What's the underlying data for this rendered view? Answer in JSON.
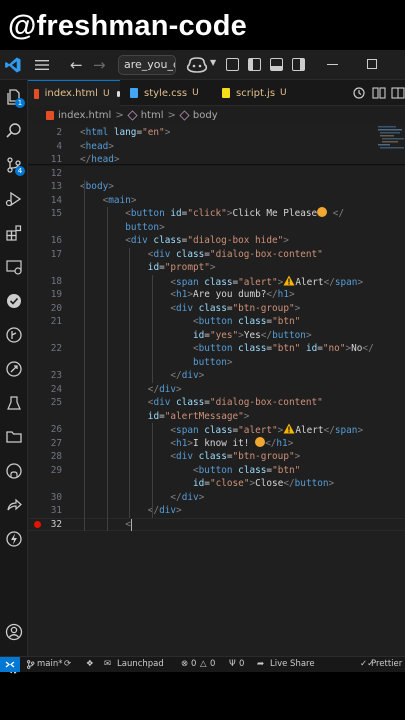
{
  "watermark": "@freshman-code",
  "titlebar": {
    "search_value": "are_you_dumb"
  },
  "tabs": [
    {
      "label": "index.html",
      "status": "U",
      "modified": true,
      "active": true,
      "color": "#e44d26"
    },
    {
      "label": "style.css",
      "status": "U",
      "active": false,
      "color": "#42a5f5"
    },
    {
      "label": "script.js",
      "status": "U",
      "active": false,
      "color": "#f5de19"
    }
  ],
  "breadcrumb": {
    "file": "index.html",
    "sep": ">",
    "html": "html",
    "body": "body"
  },
  "activity_badges": {
    "explorer": "1",
    "source_control": "4"
  },
  "editor": {
    "lines": [
      {
        "n": "2",
        "indent": 0,
        "parts": [
          [
            "t",
            "<"
          ],
          [
            "tag",
            "html"
          ],
          [
            "attr",
            " lang"
          ],
          [
            "txt",
            "="
          ],
          [
            "str",
            "\"en\""
          ],
          [
            "t",
            ">"
          ]
        ]
      },
      {
        "n": "4",
        "indent": 0,
        "parts": [
          [
            "t",
            "<"
          ],
          [
            "tag",
            "head"
          ],
          [
            "t",
            ">"
          ]
        ]
      },
      {
        "n": "11",
        "indent": 0,
        "parts": [
          [
            "t",
            "</"
          ],
          [
            "tag",
            "head"
          ],
          [
            "t",
            ">"
          ]
        ]
      },
      {
        "n": "12",
        "indent": 0,
        "parts": []
      },
      {
        "n": "13",
        "indent": 0,
        "parts": [
          [
            "t",
            "<"
          ],
          [
            "tag",
            "body"
          ],
          [
            "t",
            ">"
          ]
        ]
      },
      {
        "n": "14",
        "indent": 1,
        "parts": [
          [
            "t",
            "<"
          ],
          [
            "tag",
            "main"
          ],
          [
            "t",
            ">"
          ]
        ]
      },
      {
        "n": "15",
        "indent": 2,
        "parts": [
          [
            "t",
            "<"
          ],
          [
            "tag",
            "button"
          ],
          [
            "attr",
            " id"
          ],
          [
            "txt",
            "="
          ],
          [
            "str",
            "\"click\""
          ],
          [
            "t",
            ">"
          ],
          [
            "txt",
            "Click Me Please"
          ],
          [
            "emoji",
            ""
          ],
          [
            "t",
            " </"
          ]
        ]
      },
      {
        "n": "",
        "indent": 2,
        "parts": [
          [
            "tag",
            "button"
          ],
          [
            "t",
            ">"
          ]
        ]
      },
      {
        "n": "16",
        "indent": 2,
        "parts": [
          [
            "t",
            "<"
          ],
          [
            "tag",
            "div"
          ],
          [
            "attr",
            " class"
          ],
          [
            "txt",
            "="
          ],
          [
            "str",
            "\"dialog-box hide\""
          ],
          [
            "t",
            ">"
          ]
        ]
      },
      {
        "n": "17",
        "indent": 3,
        "parts": [
          [
            "t",
            "<"
          ],
          [
            "tag",
            "div"
          ],
          [
            "attr",
            " class"
          ],
          [
            "txt",
            "="
          ],
          [
            "str",
            "\"dialog-box-content\""
          ]
        ]
      },
      {
        "n": "",
        "indent": 3,
        "parts": [
          [
            "attr",
            "id"
          ],
          [
            "txt",
            "="
          ],
          [
            "str",
            "\"prompt\""
          ],
          [
            "t",
            ">"
          ]
        ]
      },
      {
        "n": "18",
        "indent": 4,
        "parts": [
          [
            "t",
            "<"
          ],
          [
            "tag",
            "span"
          ],
          [
            "attr",
            " class"
          ],
          [
            "txt",
            "="
          ],
          [
            "str",
            "\"alert\""
          ],
          [
            "t",
            ">"
          ],
          [
            "warn",
            ""
          ],
          [
            "txt",
            "Alert"
          ],
          [
            "t",
            "</"
          ],
          [
            "tag",
            "span"
          ],
          [
            "t",
            ">"
          ]
        ]
      },
      {
        "n": "19",
        "indent": 4,
        "parts": [
          [
            "t",
            "<"
          ],
          [
            "tag",
            "h1"
          ],
          [
            "t",
            ">"
          ],
          [
            "txt",
            "Are you dumb?"
          ],
          [
            "t",
            "</"
          ],
          [
            "tag",
            "h1"
          ],
          [
            "t",
            ">"
          ]
        ]
      },
      {
        "n": "20",
        "indent": 4,
        "parts": [
          [
            "t",
            "<"
          ],
          [
            "tag",
            "div"
          ],
          [
            "attr",
            " class"
          ],
          [
            "txt",
            "="
          ],
          [
            "str",
            "\"btn-group\""
          ],
          [
            "t",
            ">"
          ]
        ]
      },
      {
        "n": "21",
        "indent": 5,
        "parts": [
          [
            "t",
            "<"
          ],
          [
            "tag",
            "button"
          ],
          [
            "attr",
            " class"
          ],
          [
            "txt",
            "="
          ],
          [
            "str",
            "\"btn\""
          ]
        ]
      },
      {
        "n": "",
        "indent": 5,
        "parts": [
          [
            "attr",
            "id"
          ],
          [
            "txt",
            "="
          ],
          [
            "str",
            "\"yes\""
          ],
          [
            "t",
            ">"
          ],
          [
            "txt",
            "Yes"
          ],
          [
            "t",
            "</"
          ],
          [
            "tag",
            "button"
          ],
          [
            "t",
            ">"
          ]
        ]
      },
      {
        "n": "22",
        "indent": 5,
        "parts": [
          [
            "t",
            "<"
          ],
          [
            "tag",
            "button"
          ],
          [
            "attr",
            " class"
          ],
          [
            "txt",
            "="
          ],
          [
            "str",
            "\"btn\""
          ],
          [
            "attr",
            " id"
          ],
          [
            "txt",
            "="
          ],
          [
            "str",
            "\"no\""
          ],
          [
            "t",
            ">"
          ],
          [
            "txt",
            "No"
          ],
          [
            "t",
            "</"
          ]
        ]
      },
      {
        "n": "",
        "indent": 5,
        "parts": [
          [
            "tag",
            "button"
          ],
          [
            "t",
            ">"
          ]
        ]
      },
      {
        "n": "23",
        "indent": 4,
        "parts": [
          [
            "t",
            "</"
          ],
          [
            "tag",
            "div"
          ],
          [
            "t",
            ">"
          ]
        ]
      },
      {
        "n": "24",
        "indent": 3,
        "parts": [
          [
            "t",
            "</"
          ],
          [
            "tag",
            "div"
          ],
          [
            "t",
            ">"
          ]
        ]
      },
      {
        "n": "25",
        "indent": 3,
        "parts": [
          [
            "t",
            "<"
          ],
          [
            "tag",
            "div"
          ],
          [
            "attr",
            " class"
          ],
          [
            "txt",
            "="
          ],
          [
            "str",
            "\"dialog-box-content\""
          ]
        ]
      },
      {
        "n": "",
        "indent": 3,
        "parts": [
          [
            "attr",
            "id"
          ],
          [
            "txt",
            "="
          ],
          [
            "str",
            "\"alertMessage\""
          ],
          [
            "t",
            ">"
          ]
        ]
      },
      {
        "n": "26",
        "indent": 4,
        "parts": [
          [
            "t",
            "<"
          ],
          [
            "tag",
            "span"
          ],
          [
            "attr",
            " class"
          ],
          [
            "txt",
            "="
          ],
          [
            "str",
            "\"alert\""
          ],
          [
            "t",
            ">"
          ],
          [
            "warn",
            ""
          ],
          [
            "txt",
            "Alert"
          ],
          [
            "t",
            "</"
          ],
          [
            "tag",
            "span"
          ],
          [
            "t",
            ">"
          ]
        ]
      },
      {
        "n": "27",
        "indent": 4,
        "parts": [
          [
            "t",
            "<"
          ],
          [
            "tag",
            "h1"
          ],
          [
            "t",
            ">"
          ],
          [
            "txt",
            "I know it! "
          ],
          [
            "emoji",
            ""
          ],
          [
            "t",
            "</"
          ],
          [
            "tag",
            "h1"
          ],
          [
            "t",
            ">"
          ]
        ]
      },
      {
        "n": "28",
        "indent": 4,
        "parts": [
          [
            "t",
            "<"
          ],
          [
            "tag",
            "div"
          ],
          [
            "attr",
            " class"
          ],
          [
            "txt",
            "="
          ],
          [
            "str",
            "\"btn-group\""
          ],
          [
            "t",
            ">"
          ]
        ]
      },
      {
        "n": "29",
        "indent": 5,
        "parts": [
          [
            "t",
            "<"
          ],
          [
            "tag",
            "button"
          ],
          [
            "attr",
            " class"
          ],
          [
            "txt",
            "="
          ],
          [
            "str",
            "\"btn\""
          ]
        ]
      },
      {
        "n": "",
        "indent": 5,
        "parts": [
          [
            "attr",
            "id"
          ],
          [
            "txt",
            "="
          ],
          [
            "str",
            "\"close\""
          ],
          [
            "t",
            ">"
          ],
          [
            "txt",
            "Close"
          ],
          [
            "t",
            "</"
          ],
          [
            "tag",
            "button"
          ],
          [
            "t",
            ">"
          ]
        ]
      },
      {
        "n": "30",
        "indent": 4,
        "parts": [
          [
            "t",
            "</"
          ],
          [
            "tag",
            "div"
          ],
          [
            "t",
            ">"
          ]
        ]
      },
      {
        "n": "31",
        "indent": 3,
        "parts": [
          [
            "t",
            "</"
          ],
          [
            "tag",
            "div"
          ],
          [
            "t",
            ">"
          ]
        ]
      },
      {
        "n": "32",
        "indent": 2,
        "parts": [
          [
            "t",
            "<"
          ]
        ],
        "current": true,
        "breakpoint": true
      }
    ]
  },
  "statusbar": {
    "branch": "main*",
    "launchpad": "Launchpad",
    "errors": "0",
    "warnings": "0",
    "ports": "0",
    "live_share": "Live Share",
    "prettier": "Prettier"
  },
  "colors": {
    "accent": "#0078d4",
    "tab_modified": "#e2c08d",
    "breakpoint": "#e51400"
  }
}
